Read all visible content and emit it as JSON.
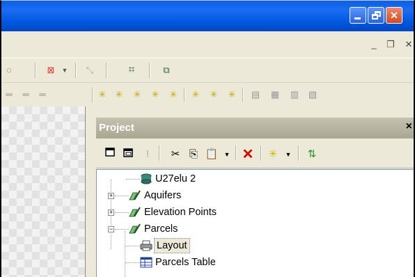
{
  "titlebar": {
    "buttons": {
      "minimize": "minimize",
      "maximize": "restore",
      "close": "close"
    },
    "gradient": "#0058e0"
  },
  "mdi": {
    "icons": [
      "minimize-icon",
      "restore-icon",
      "close-icon"
    ]
  },
  "project": {
    "title": "Project",
    "close_glyph": "×",
    "toolbar_icons": [
      "new-window-icon",
      "cascade-icon",
      "properties-icon",
      "cut-icon",
      "copy-icon",
      "paste-icon",
      "delete-icon",
      "add-layer-icon",
      "refresh-icon"
    ],
    "tree": [
      {
        "label": "U27elu 2",
        "icon": "database-icon",
        "level": 0,
        "expander": ""
      },
      {
        "label": "Aquifers",
        "icon": "layer-edit-icon",
        "level": 1,
        "expander": "+"
      },
      {
        "label": "Elevation Points",
        "icon": "layer-edit-icon",
        "level": 1,
        "expander": "+"
      },
      {
        "label": "Parcels",
        "icon": "layer-edit-icon",
        "level": 1,
        "expander": "−"
      },
      {
        "label": "Layout",
        "icon": "printer-icon",
        "level": 2,
        "expander": "",
        "selected": true
      },
      {
        "label": "Parcels Table",
        "icon": "table-icon",
        "level": 2,
        "expander": ""
      }
    ]
  },
  "colors": {
    "accent": "#0058e0",
    "panel": "#ece9d8",
    "selection": "#ece9d8"
  }
}
